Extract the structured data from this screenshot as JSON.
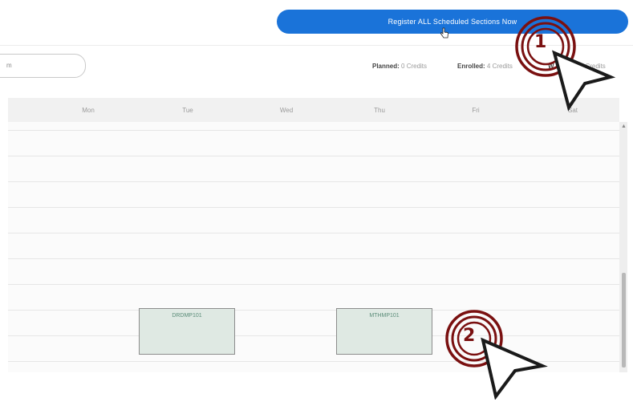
{
  "toolbar": {
    "register_label": "Register ALL Scheduled Sections Now"
  },
  "term": {
    "value": "m"
  },
  "credits": {
    "planned_label": "Planned:",
    "planned_value": "0 Credits",
    "enrolled_label": "Enrolled:",
    "enrolled_value": "4 Credits",
    "waitlisted_label": "W",
    "waitlisted_value": "0 Credits"
  },
  "calendar": {
    "days": [
      "Mon",
      "Tue",
      "Wed",
      "Thu",
      "Fri",
      "Sat"
    ],
    "events": [
      {
        "label": "DRDMP101"
      },
      {
        "label": "MTHMP101"
      }
    ]
  },
  "annotations": [
    {
      "number": "1"
    },
    {
      "number": "2"
    }
  ],
  "colors": {
    "accent": "#1a73d9",
    "annotation": "#7a1010",
    "event_fill": "#dfe9e3"
  }
}
